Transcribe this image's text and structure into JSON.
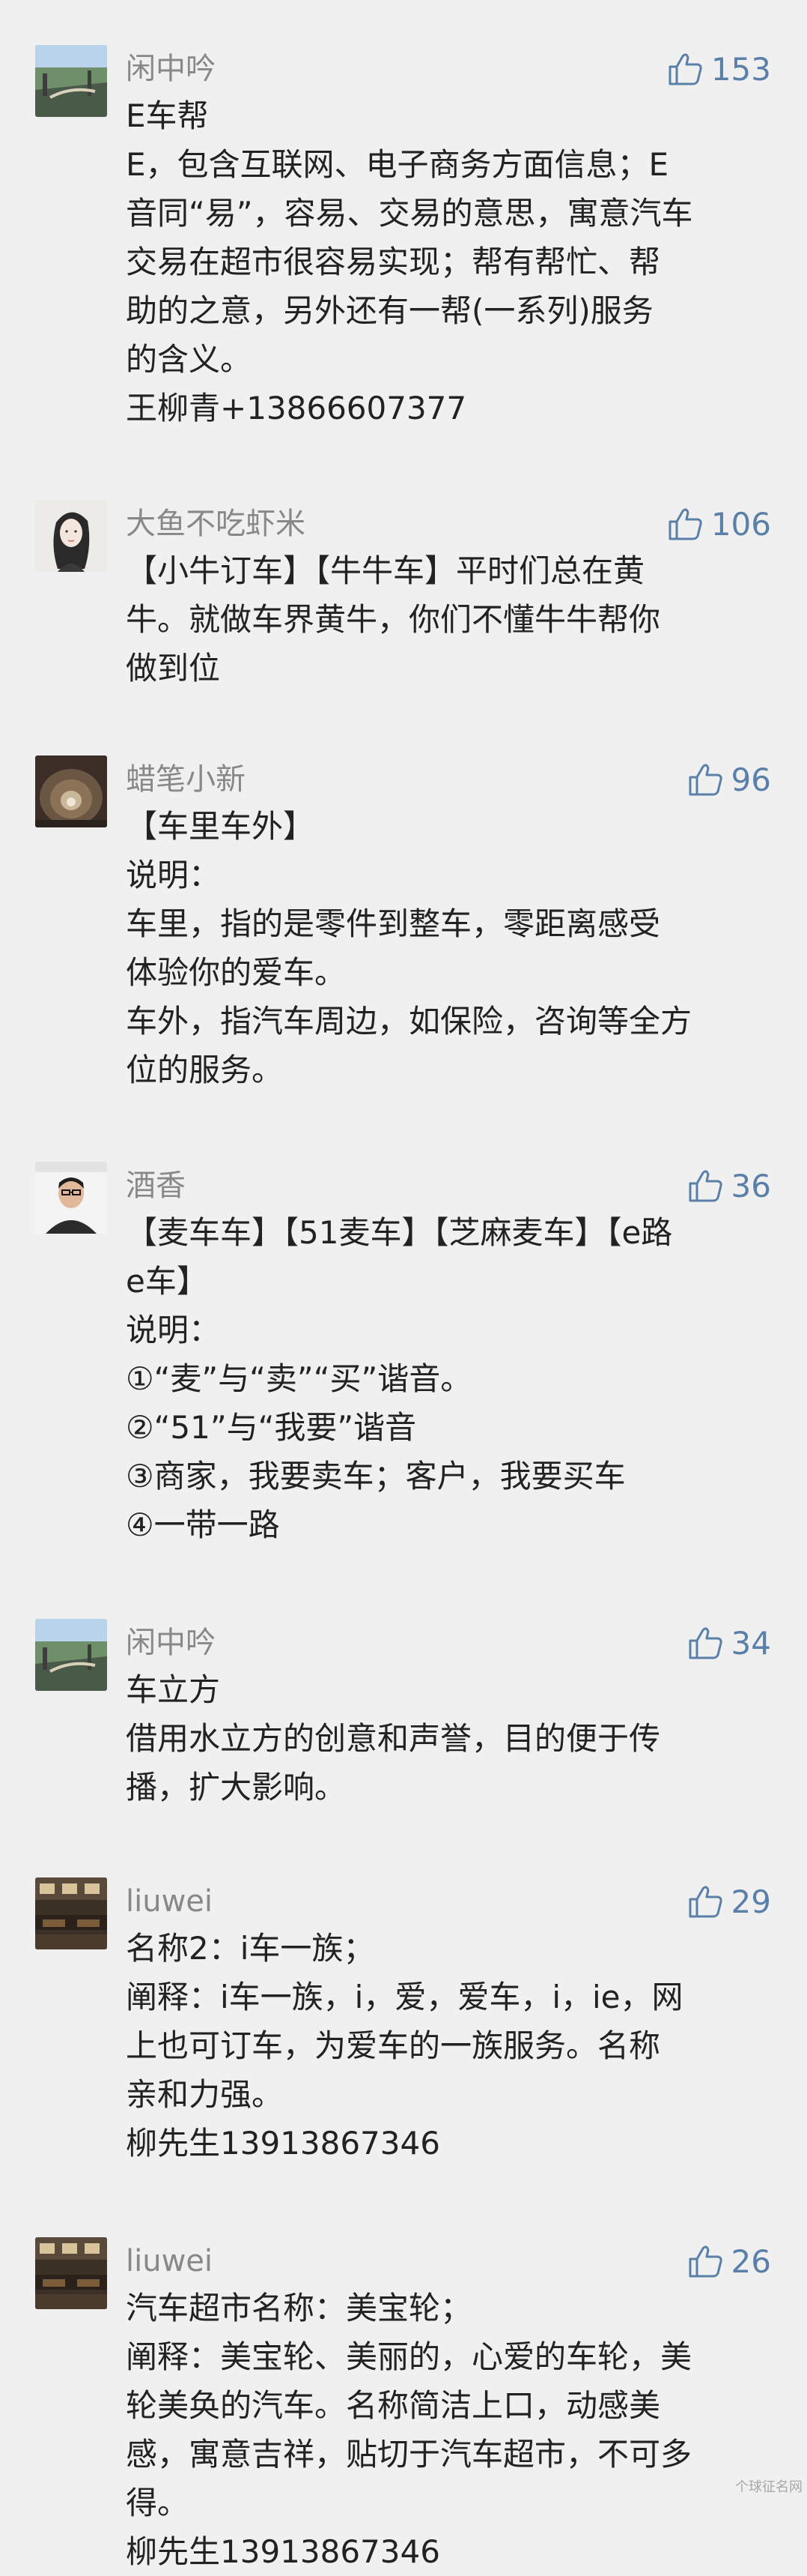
{
  "comments": [
    {
      "avatar": "landscape-avatar",
      "username": "闲中吟",
      "likes": "153",
      "lines": [
        "E车帮",
        "E，包含互联网、电子商务方面信息；E",
        "音同“易”，容易、交易的意思，寓意汽车",
        "交易在超市很容易实现；帮有帮忙、帮",
        "助的之意，另外还有一帮(一系列)服务",
        "的含义。",
        "王柳青+13866607377"
      ]
    },
    {
      "avatar": "girl-avatar",
      "username": "大鱼不吃虾米",
      "likes": "106",
      "lines": [
        "【小牛订车】【牛牛车】平时们总在黄",
        "牛。就做车界黄牛，你们不懂牛牛帮你",
        "做到位"
      ]
    },
    {
      "avatar": "tunnel-avatar",
      "username": "蜡笔小新",
      "likes": "96",
      "lines": [
        "【车里车外】",
        "说明：",
        "车里，指的是零件到整车，零距离感受",
        "体验你的爱车。",
        "车外，指汽车周边，如保险，咨询等全方",
        "位的服务。"
      ]
    },
    {
      "avatar": "man-avatar",
      "username": "酒香",
      "likes": "36",
      "lines": [
        "【麦车车】【51麦车】【芝麻麦车】【e路",
        "e车】",
        "说明：",
        "①“麦”与“卖”“买”谐音。",
        "②“51”与“我要”谐音",
        "③商家，我要卖车；客户，我要买车",
        "④一带一路"
      ]
    },
    {
      "avatar": "landscape-avatar",
      "username": "闲中吟",
      "likes": "34",
      "lines": [
        "车立方",
        "借用水立方的创意和声誉，目的便于传",
        "播，扩大影响。"
      ]
    },
    {
      "avatar": "interior-avatar",
      "username": "liuwei",
      "likes": "29",
      "lines": [
        "名称2：i车一族；",
        "阐释：i车一族，i，爱，爱车，i，ie，网",
        "上也可订车，为爱车的一族服务。名称",
        "亲和力强。",
        "柳先生13913867346"
      ]
    },
    {
      "avatar": "interior-avatar",
      "username": "liuwei",
      "likes": "26",
      "lines": [
        "汽车超市名称：美宝轮；",
        "阐释：美宝轮、美丽的，心爱的车轮，美",
        "轮美奂的汽车。名称简洁上口，动感美",
        "感，寓意吉祥，贴切于汽车超市，不可多",
        "得。",
        "柳先生13913867346"
      ]
    }
  ],
  "watermark": "个球征名网",
  "colors": {
    "background": "#f0f0f0",
    "username": "#888888",
    "like": "#5a7fa8",
    "text": "#222222"
  },
  "icons": {
    "like": "thumbs-up-icon"
  }
}
